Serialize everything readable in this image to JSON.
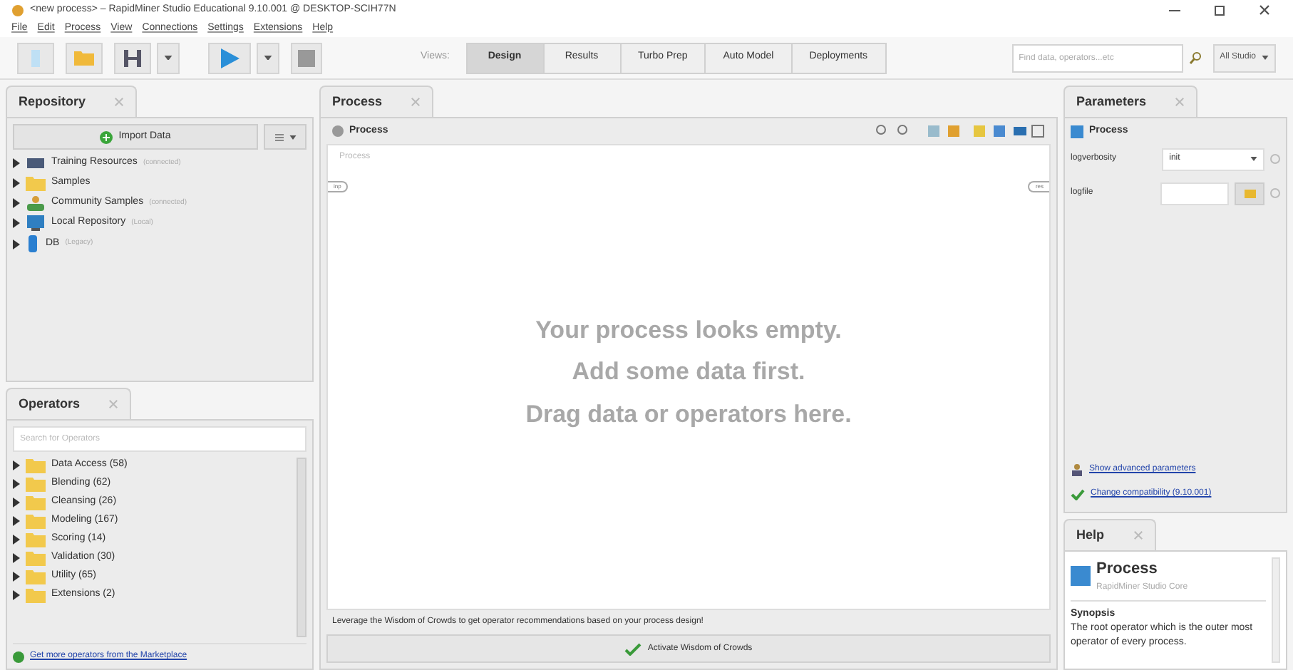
{
  "window": {
    "title": "<new process> – RapidMiner Studio Educational 9.10.001 @ DESKTOP-SCIH77N"
  },
  "menu": [
    "File",
    "Edit",
    "Process",
    "View",
    "Connections",
    "Settings",
    "Extensions",
    "Help"
  ],
  "views": {
    "label": "Views:",
    "tabs": [
      {
        "label": "Design",
        "selected": true
      },
      {
        "label": "Results",
        "selected": false
      },
      {
        "label": "Turbo Prep",
        "selected": false
      },
      {
        "label": "Auto Model",
        "selected": false
      },
      {
        "label": "Deployments",
        "selected": false
      }
    ]
  },
  "global_search": {
    "placeholder": "Find data, operators...etc",
    "scope": "All Studio"
  },
  "repository": {
    "title": "Repository",
    "import_button": "Import Data",
    "items": [
      {
        "kind": "training",
        "name": "Training Resources",
        "note": "(connected)"
      },
      {
        "kind": "folder",
        "name": "Samples"
      },
      {
        "kind": "community",
        "name": "Community Samples",
        "note": "(connected)"
      },
      {
        "kind": "local",
        "name": "Local Repository",
        "note": "(Local)"
      },
      {
        "kind": "db",
        "name": "DB",
        "note": "(Legacy)"
      }
    ]
  },
  "operators": {
    "title": "Operators",
    "placeholder": "Search for Operators",
    "items": [
      "Data Access (58)",
      "Blending (62)",
      "Cleansing (26)",
      "Modeling (167)",
      "Scoring (14)",
      "Validation (30)",
      "Utility (65)",
      "Extensions (2)"
    ],
    "marketplace_link": "Get more operators from the Marketplace"
  },
  "process": {
    "tab": "Process",
    "breadcrumb": "Process",
    "canvas_label": "Process",
    "input_port": "inp",
    "output_port": "res",
    "empty_message": [
      "Your process looks empty.",
      "Add some data first.",
      "Drag data or operators here."
    ],
    "wisdom_text": "Leverage the Wisdom of Crowds to get operator recommendations based on your process design!",
    "wisdom_button": "Activate Wisdom of Crowds"
  },
  "parameters": {
    "title": "Parameters",
    "operator": "Process",
    "rows": [
      {
        "kind": "select",
        "label": "logverbosity",
        "value": "init"
      },
      {
        "kind": "file",
        "label": "logfile"
      }
    ],
    "links": [
      {
        "kind": "advanced",
        "text": "Show advanced parameters"
      },
      {
        "kind": "compat",
        "text": "Change compatibility (9.10.001)"
      }
    ]
  },
  "help": {
    "title": "Help",
    "operator": "Process",
    "subtitle": "RapidMiner Studio Core",
    "heading": "Synopsis",
    "text": "The root operator which is the outer most operator of every process."
  }
}
